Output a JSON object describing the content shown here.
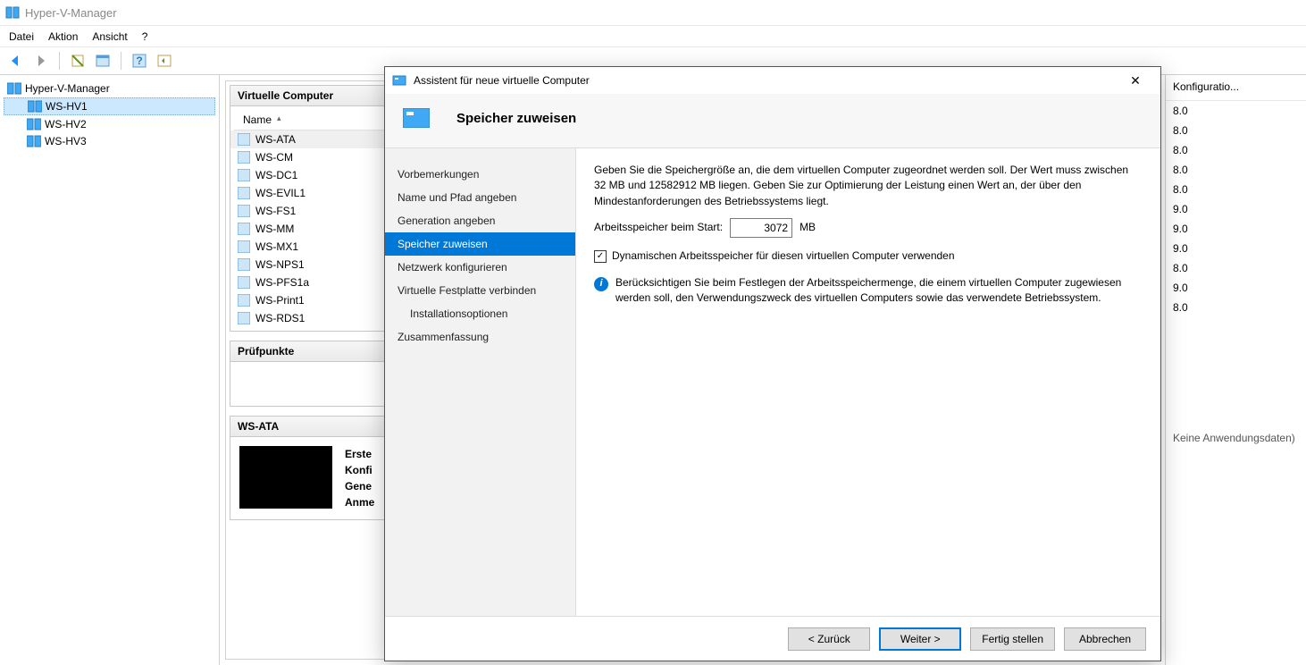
{
  "app": {
    "title": "Hyper-V-Manager"
  },
  "menu": {
    "file": "Datei",
    "action": "Aktion",
    "view": "Ansicht",
    "help": "?"
  },
  "tree": {
    "root": "Hyper-V-Manager",
    "hosts": [
      "WS-HV1",
      "WS-HV2",
      "WS-HV3"
    ]
  },
  "vms": {
    "header": "Virtuelle Computer",
    "col_name": "Name",
    "col_config": "Konfiguratio...",
    "rows": [
      {
        "name": "WS-ATA",
        "config": "8.0"
      },
      {
        "name": "WS-CM",
        "config": "8.0"
      },
      {
        "name": "WS-DC1",
        "config": "8.0"
      },
      {
        "name": "WS-EVIL1",
        "config": "8.0"
      },
      {
        "name": "WS-FS1",
        "config": "8.0"
      },
      {
        "name": "WS-MM",
        "config": "9.0"
      },
      {
        "name": "WS-MX1",
        "config": "9.0"
      },
      {
        "name": "WS-NPS1",
        "config": "9.0"
      },
      {
        "name": "WS-PFS1a",
        "config": "8.0"
      },
      {
        "name": "WS-Print1",
        "config": "9.0"
      },
      {
        "name": "WS-RDS1",
        "config": "8.0"
      }
    ]
  },
  "checkpoints": {
    "header": "Prüfpunkte"
  },
  "details": {
    "header": "WS-ATA",
    "rows": {
      "created": "Erste",
      "config": "Konfi",
      "gen": "Gene",
      "notes": "Anme"
    },
    "no_cluster": "Keine Anwendungsdaten)"
  },
  "wizard": {
    "title": "Assistent für neue virtuelle Computer",
    "hero": "Speicher zuweisen",
    "steps": [
      "Vorbemerkungen",
      "Name und Pfad angeben",
      "Generation angeben",
      "Speicher zuweisen",
      "Netzwerk konfigurieren",
      "Virtuelle Festplatte verbinden",
      "Installationsoptionen",
      "Zusammenfassung"
    ],
    "desc": "Geben Sie die Speichergröße an, die dem virtuellen Computer zugeordnet werden soll. Der Wert muss zwischen 32 MB und 12582912 MB liegen. Geben Sie zur Optimierung der Leistung einen Wert an, der über den Mindestanforderungen des Betriebssystems liegt.",
    "mem_label": "Arbeitsspeicher beim Start:",
    "mem_value": "3072",
    "mem_unit": "MB",
    "dyn_label": "Dynamischen Arbeitsspeicher für diesen virtuellen Computer verwenden",
    "info": "Berücksichtigen Sie beim Festlegen der Arbeitsspeichermenge, die einem virtuellen Computer zugewiesen werden soll, den Verwendungszweck des virtuellen Computers sowie das verwendete Betriebssystem.",
    "buttons": {
      "back": "< Zurück",
      "next": "Weiter >",
      "finish": "Fertig stellen",
      "cancel": "Abbrechen"
    }
  }
}
